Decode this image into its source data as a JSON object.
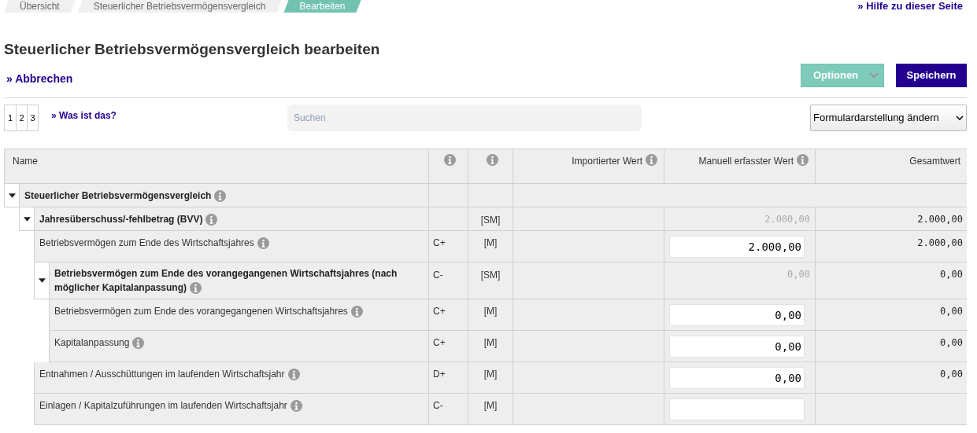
{
  "breadcrumb": [
    {
      "label": "Übersicht",
      "selected": false
    },
    {
      "label": "Steuerlicher Betriebsvermögensvergleich",
      "selected": false
    },
    {
      "label": "Bearbeiten",
      "selected": true
    }
  ],
  "help_link": "» Hilfe zu dieser Seite",
  "title": "Steuerlicher Betriebsvermögensvergleich bearbeiten",
  "cancel_link": "» Abbrechen",
  "buttons": {
    "options": "Optionen",
    "save": "Speichern"
  },
  "pages": [
    {
      "label": "1"
    },
    {
      "label": "2"
    },
    {
      "label": "3"
    }
  ],
  "whats_this_link": "» Was ist das?",
  "search": {
    "placeholder": "Suchen"
  },
  "view_select": "Formulardarstellung ändern",
  "table": {
    "columns": [
      {
        "label": "Name",
        "info": false
      },
      {
        "info": true
      },
      {
        "info": true
      },
      {
        "label": "Importierter Wert",
        "info": true
      },
      {
        "label": "Manuell erfasster Wert",
        "info": true
      },
      {
        "label": "Gesamtwert",
        "info": false
      }
    ],
    "rows": [
      {
        "kind": "group",
        "name": "Steuerlicher Betriebsvermögensvergleich",
        "expanded": true,
        "children": [
          {
            "kind": "group",
            "name": "Jahresüberschuss/-fehlbetrag (BVV)",
            "expanded": true,
            "type": "[SM]",
            "manual": "2.000,00",
            "total": "2.000,00",
            "children": [
              {
                "kind": "field",
                "name": "Betriebsvermögen zum Ende des Wirtschaftsjahres",
                "code": "C+",
                "type": "[M]",
                "manual": "2.000,00",
                "total": "2.000,00"
              },
              {
                "kind": "group",
                "name": "Betriebsvermögen zum Ende des vorangegangenen Wirtschaftsjahres (nach möglicher Kapitalanpassung)",
                "expanded": true,
                "code": "C-",
                "type": "[SM]",
                "manual": "0,00",
                "total": "0,00",
                "children": [
                  {
                    "kind": "field",
                    "name": "Betriebsvermögen zum Ende des vorangegangenen Wirtschaftsjahres",
                    "code": "C+",
                    "type": "[M]",
                    "manual": "0,00",
                    "total": "0,00"
                  },
                  {
                    "kind": "field",
                    "name": "Kapitalanpassung",
                    "code": "C+",
                    "type": "[M]",
                    "manual": "0,00",
                    "total": "0,00"
                  }
                ]
              },
              {
                "kind": "field",
                "name": "Entnahmen / Ausschüttungen im laufenden Wirtschaftsjahr",
                "code": "D+",
                "type": "[M]",
                "manual": "0,00",
                "total": "0,00"
              },
              {
                "kind": "field",
                "name": "Einlagen / Kapitalzuführungen im laufenden Wirtschaftsjahr",
                "code": "C-",
                "type": "[M]"
              }
            ]
          }
        ]
      }
    ]
  }
}
